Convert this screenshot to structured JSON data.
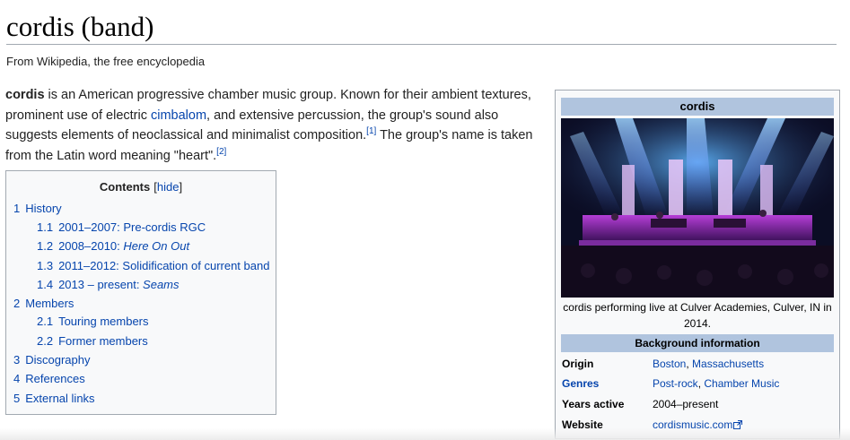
{
  "page": {
    "title": "cordis (band)",
    "tagline": "From Wikipedia, the free encyclopedia"
  },
  "lead": {
    "subject": "cordis",
    "text1": " is an American progressive chamber music group. Known for their ambient textures, prominent use of electric ",
    "link_cimbalom": "cimbalom",
    "text2": ", and extensive percussion, the group's sound also suggests elements of neoclassical and minimalist composition.",
    "ref1": "[1]",
    "text3": " The group's name is taken from the Latin word meaning \"heart\".",
    "ref2": "[2]"
  },
  "toc": {
    "title": "Contents",
    "hide_label": "[hide]",
    "items": [
      {
        "num": "1",
        "label": "History"
      },
      {
        "num": "1.1",
        "label": "2001–2007: Pre-cordis RGC"
      },
      {
        "num": "1.2",
        "label_prefix": "2008–2010: ",
        "label_italic": "Here On Out"
      },
      {
        "num": "1.3",
        "label": "2011–2012: Solidification of current band"
      },
      {
        "num": "1.4",
        "label_prefix": "2013 – present: ",
        "label_italic": "Seams"
      },
      {
        "num": "2",
        "label": "Members"
      },
      {
        "num": "2.1",
        "label": "Touring members"
      },
      {
        "num": "2.2",
        "label": "Former members"
      },
      {
        "num": "3",
        "label": "Discography"
      },
      {
        "num": "4",
        "label": "References"
      },
      {
        "num": "5",
        "label": "External links"
      }
    ]
  },
  "infobox": {
    "title": "cordis",
    "caption": "cordis performing live at Culver Academies, Culver, IN in 2014.",
    "section": "Background information",
    "origin_label": "Origin",
    "origin_city": "Boston",
    "origin_sep": ", ",
    "origin_state": "Massachusetts",
    "genres_label": "Genres",
    "genre1": "Post-rock",
    "genre_sep": ", ",
    "genre2": "Chamber Music",
    "years_label": "Years active",
    "years_value": "2004–present",
    "website_label": "Website",
    "website_value": "cordismusic.com"
  },
  "colors": {
    "link": "#0645ad",
    "infobox_header": "#b0c4de",
    "panel_bg": "#f8f9fa",
    "border": "#a2a9b1"
  }
}
